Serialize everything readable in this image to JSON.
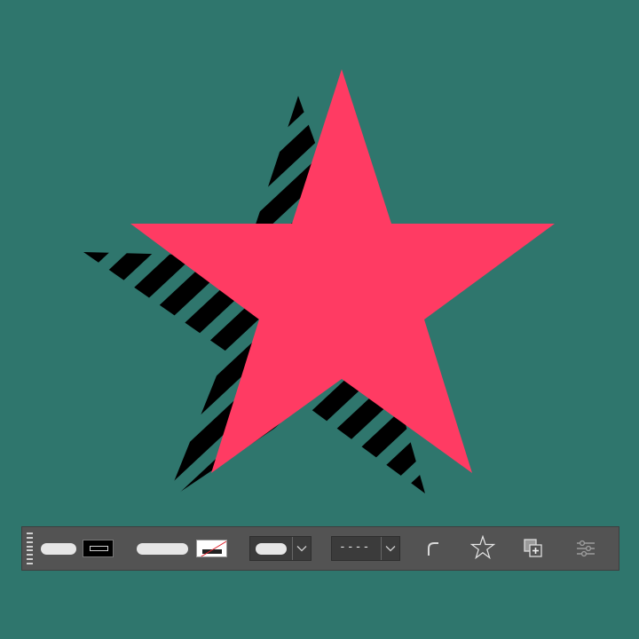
{
  "canvas": {
    "background_color": "#2f766d",
    "star_fill_color": "#ff3b63",
    "shadow_stripe_color": "#000000"
  },
  "toolbar": {
    "fill_swatch": {
      "state": "filled",
      "color": "#000000"
    },
    "stroke_swatch": {
      "state": "none",
      "color": "#ffffff"
    },
    "stroke_width_dropdown": {
      "expanded": false
    },
    "stroke_style_dropdown": {
      "value": "----",
      "expanded": false
    },
    "icons": {
      "grip": "drag-handle-icon",
      "corner": "corner-radius-icon",
      "star": "star-shape-icon",
      "combine": "combine-shapes-icon",
      "settings": "settings-sliders-icon",
      "chevron": "chevron-down-icon"
    }
  }
}
